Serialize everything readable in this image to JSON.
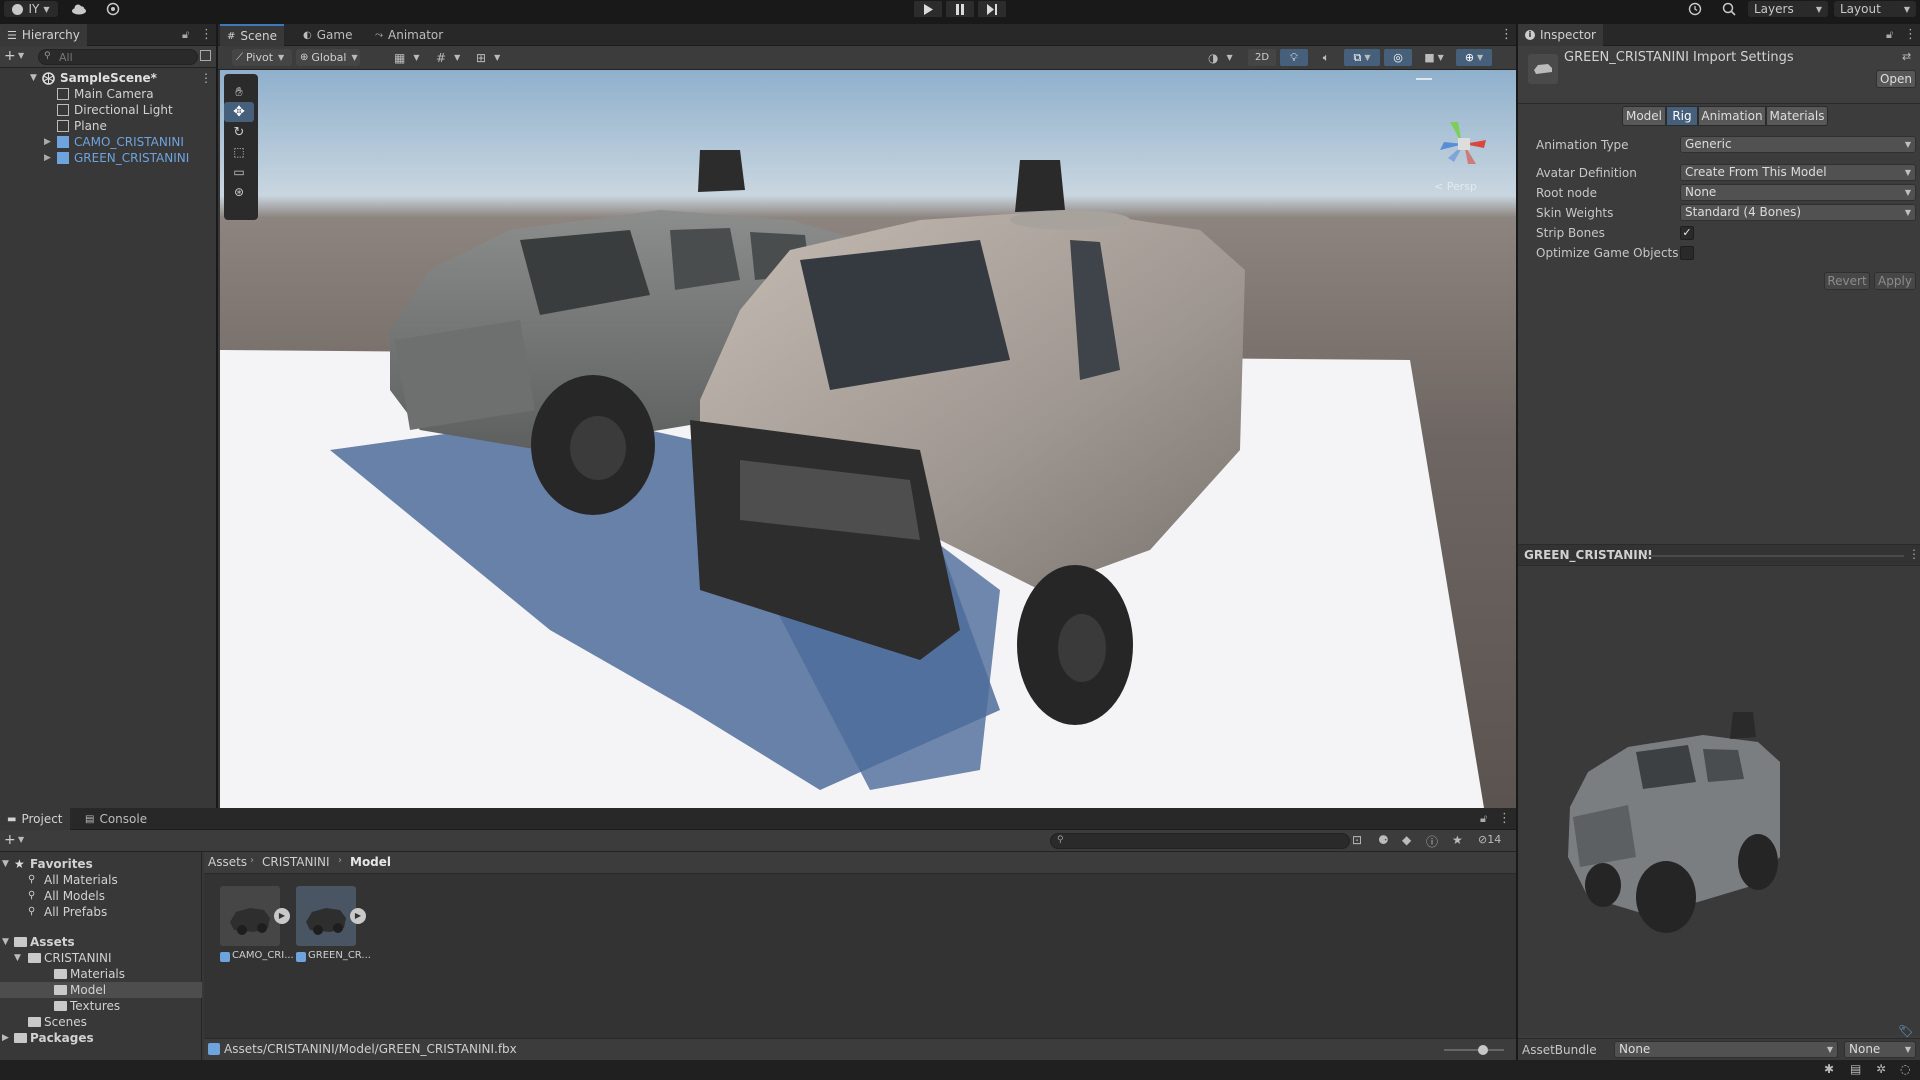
{
  "toolbar": {
    "account_label": "IY",
    "layers_label": "Layers",
    "layout_label": "Layout"
  },
  "hierarchy": {
    "tab_label": "Hierarchy",
    "search_placeholder": "All",
    "scene_name": "SampleScene*",
    "items": [
      {
        "label": "Main Camera",
        "prefab": false
      },
      {
        "label": "Directional Light",
        "prefab": false
      },
      {
        "label": "Plane",
        "prefab": false
      },
      {
        "label": "CAMO_CRISTANINI",
        "prefab": true
      },
      {
        "label": "GREEN_CRISTANINI",
        "prefab": true
      }
    ]
  },
  "scene_view": {
    "tabs": [
      "Scene",
      "Game",
      "Animator"
    ],
    "pivot_label": "Pivot",
    "global_label": "Global",
    "mode_2d_label": "2D",
    "persp_label": "< Persp"
  },
  "inspector": {
    "tab_label": "Inspector",
    "title": "GREEN_CRISTANINI Import Settings",
    "open_label": "Open",
    "tabs": [
      "Model",
      "Rig",
      "Animation",
      "Materials"
    ],
    "active_tab": "Rig",
    "fields": {
      "animation_type_label": "Animation Type",
      "animation_type_value": "Generic",
      "avatar_definition_label": "Avatar Definition",
      "avatar_definition_value": "Create From This Model",
      "root_node_label": "Root node",
      "root_node_value": "None",
      "skin_weights_label": "Skin Weights",
      "skin_weights_value": "Standard (4 Bones)",
      "strip_bones_label": "Strip Bones",
      "strip_bones_checked": true,
      "optimize_label": "Optimize Game Objects",
      "optimize_checked": false
    },
    "revert_label": "Revert",
    "apply_label": "Apply",
    "preview_title": "GREEN_CRISTANINI",
    "assetbundle_label": "AssetBundle",
    "assetbundle_value": "None",
    "assetbundle_variant": "None"
  },
  "project": {
    "tabs": [
      "Project",
      "Console"
    ],
    "favorites_label": "Favorites",
    "favorites": [
      "All Materials",
      "All Models",
      "All Prefabs"
    ],
    "assets_label": "Assets",
    "folders": [
      {
        "label": "CRISTANINI",
        "depth": 1,
        "expanded": true
      },
      {
        "label": "Materials",
        "depth": 2
      },
      {
        "label": "Model",
        "depth": 2,
        "selected": true
      },
      {
        "label": "Textures",
        "depth": 2
      },
      {
        "label": "Scenes",
        "depth": 1
      }
    ],
    "packages_label": "Packages",
    "breadcrumb": [
      "Assets",
      "CRISTANINI",
      "Model"
    ],
    "hidden_count": "14",
    "assets": [
      {
        "label": "CAMO_CRI..."
      },
      {
        "label": "GREEN_CR..."
      }
    ],
    "status_path": "Assets/CRISTANINI/Model/GREEN_CRISTANINI.fbx"
  },
  "colors": {
    "accent": "#3a79bb",
    "prefab_blue": "#6fa3de",
    "selection": "#46607c"
  }
}
